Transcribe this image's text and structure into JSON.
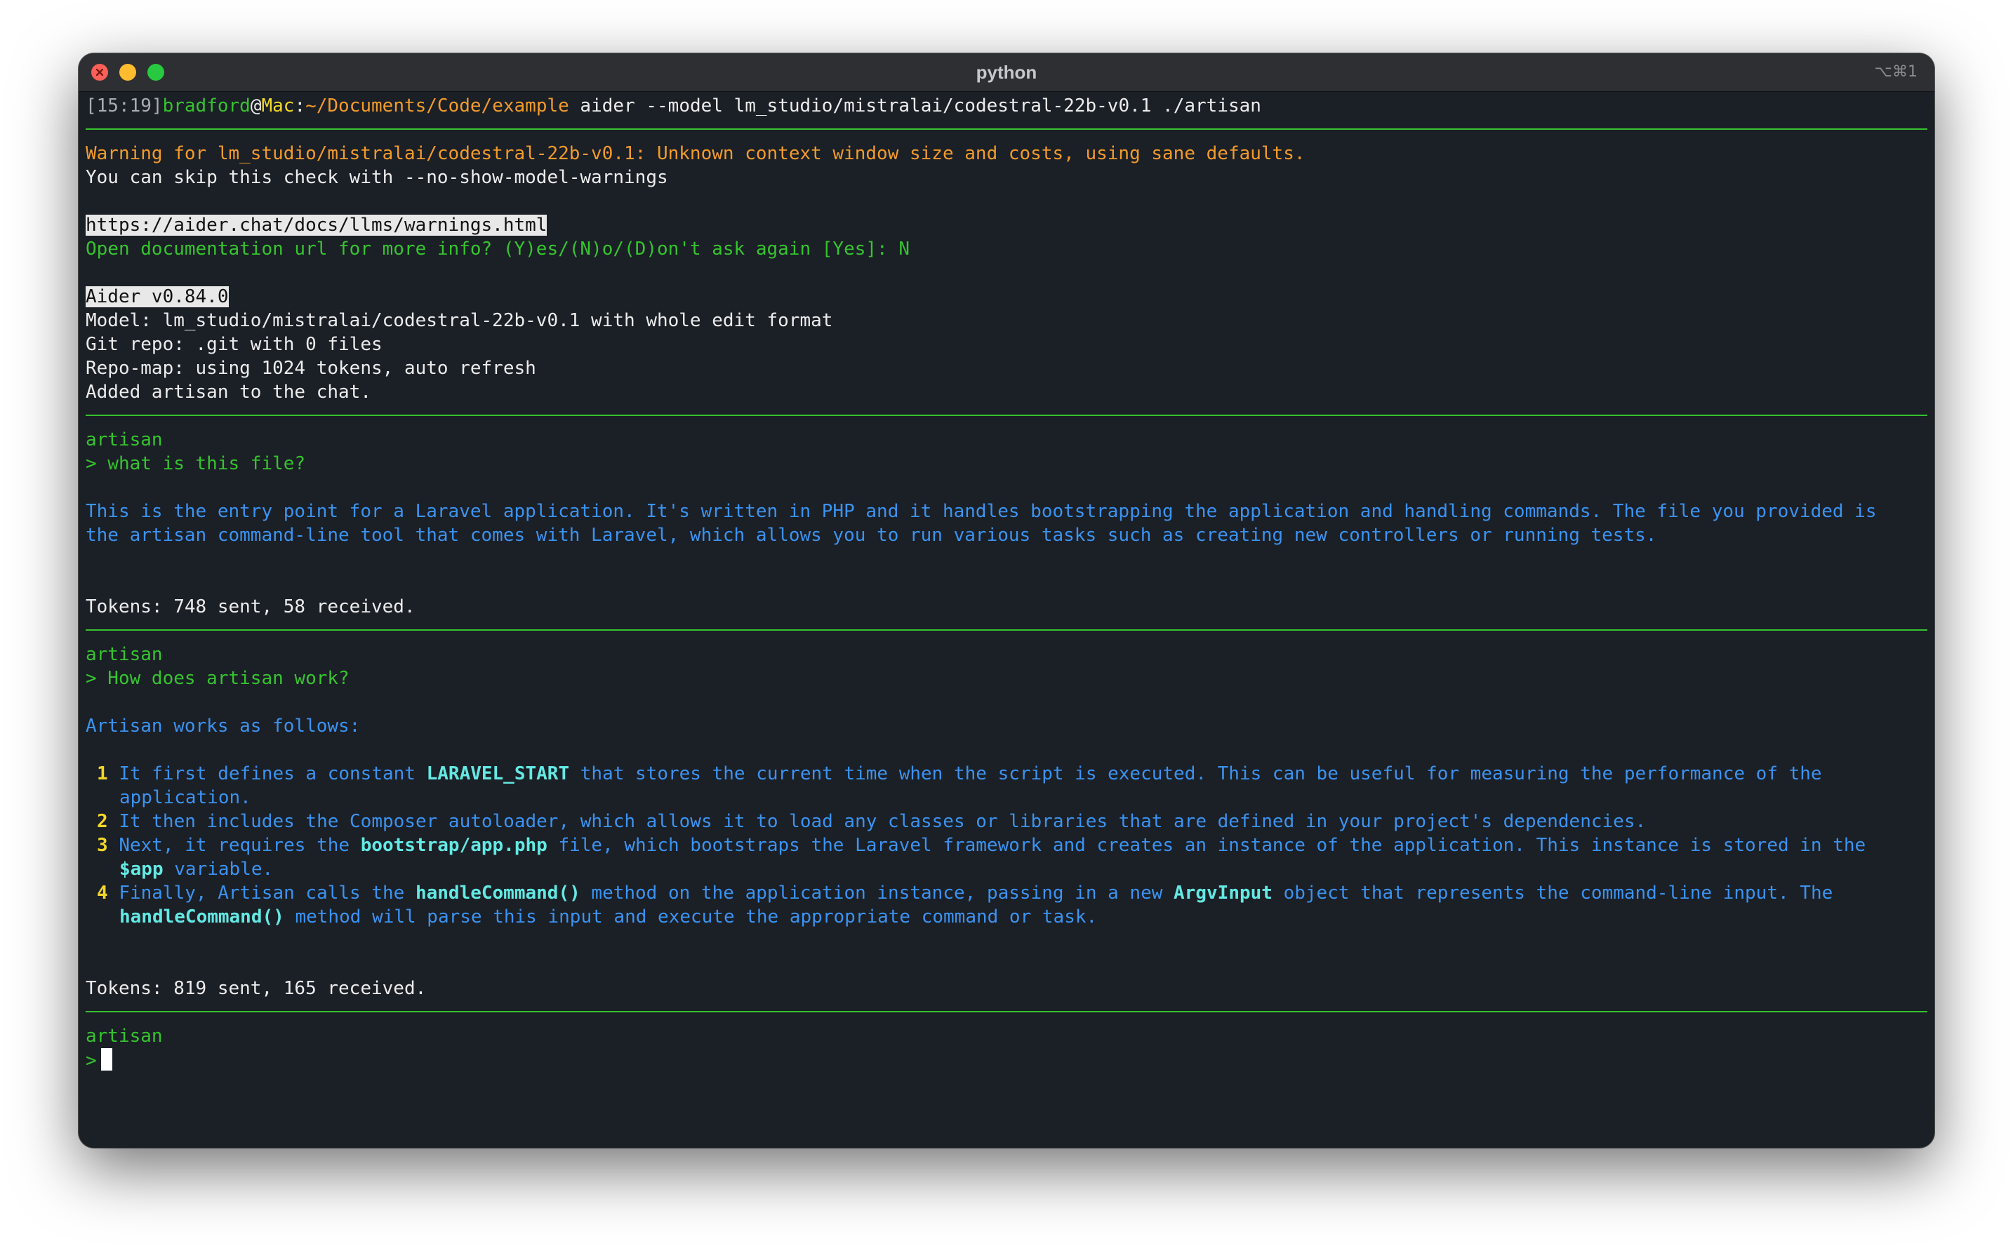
{
  "window": {
    "title": "python",
    "shortcut": "⌥⌘1"
  },
  "colors": {
    "background": "#1b1f26",
    "rule": "#36c32f",
    "warning": "#f29b2b",
    "prompt_green": "#35c42e",
    "response_blue": "#3b93f0",
    "code_cyan": "#63e9e3",
    "list_number_yellow": "#f1d62a"
  },
  "command": {
    "time": "[15:19]",
    "user": "bradford",
    "at": "@",
    "host": "Mac",
    "colon": ":",
    "path": "~/Documents/Code/example",
    "text": " aider --model lm_studio/mistralai/codestral-22b-v0.1 ./artisan"
  },
  "warning": {
    "line": "Warning for lm_studio/mistralai/codestral-22b-v0.1: Unknown context window size and costs, using sane defaults.",
    "skip": "You can skip this check with --no-show-model-warnings",
    "url": "https://aider.chat/docs/llms/warnings.html",
    "question": "Open documentation url for more info? (Y)es/(N)o/(D)on't ask again [Yes]: N"
  },
  "info": {
    "version": "Aider v0.84.0",
    "model": "Model: lm_studio/mistralai/codestral-22b-v0.1 with whole edit format",
    "git": "Git repo: .git with 0 files",
    "repomap": "Repo-map: using 1024 tokens, auto refresh",
    "added": "Added artisan to the chat."
  },
  "exchange1": {
    "file": "artisan",
    "prompt": "> what is this file?",
    "response_line1": "This is the entry point for a Laravel application. It's written in PHP and it handles bootstrapping the application and handling commands. The file you provided is",
    "response_line2": "the artisan command-line tool that comes with Laravel, which allows you to run various tasks such as creating new controllers or running tests.",
    "tokens": "Tokens: 748 sent, 58 received."
  },
  "exchange2": {
    "file": "artisan",
    "prompt": "> How does artisan work?",
    "intro": "Artisan works as follows:",
    "items": [
      {
        "num": "1",
        "a": "It first defines a constant ",
        "code1": "LARAVEL_START",
        "b": " that stores the current time when the script is executed. This can be useful for measuring the performance of the",
        "c": "application."
      },
      {
        "num": "2",
        "a": "It then includes the Composer autoloader, which allows it to load any classes or libraries that are defined in your project's dependencies."
      },
      {
        "num": "3",
        "a": "Next, it requires the ",
        "code1": "bootstrap/app.php",
        "b": " file, which bootstraps the Laravel framework and creates an instance of the application. This instance is stored in the",
        "code2": "$app",
        "c": " variable."
      },
      {
        "num": "4",
        "a": "Finally, Artisan calls the ",
        "code1": "handleCommand()",
        "b": " method on the application instance, passing in a new ",
        "code2": "ArgvInput",
        "c": " object that represents the command-line input. The",
        "code3": "handleCommand()",
        "d": " method will parse this input and execute the appropriate command or task."
      }
    ],
    "tokens": "Tokens: 819 sent, 165 received."
  },
  "current": {
    "file": "artisan",
    "prompt": ">"
  }
}
